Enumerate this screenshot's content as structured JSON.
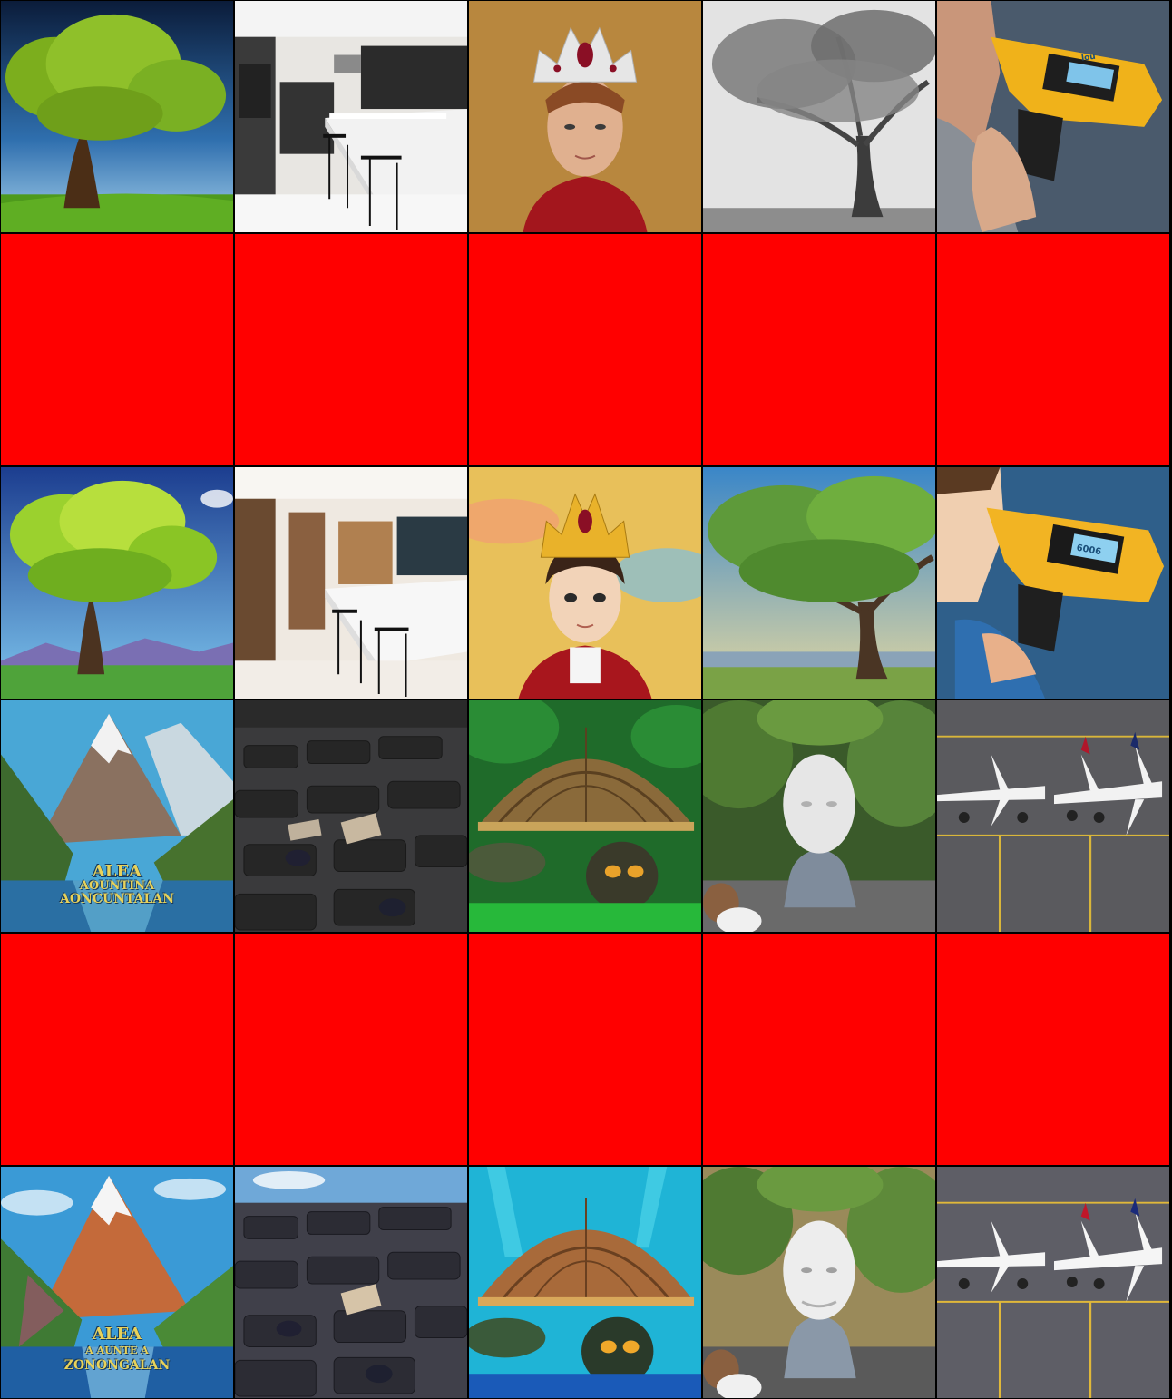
{
  "grid": {
    "columns": 5,
    "rows": 6,
    "placeholder_color": "#ff0000"
  },
  "rows": [
    {
      "kind": "photo",
      "tiles": [
        "tree-photo",
        "kitchen-photo",
        "crowned-woman-photo",
        "bw-oak-tree-photo",
        "power-drill-photo"
      ]
    },
    {
      "kind": "placeholder",
      "tiles": [
        "red-block",
        "red-block",
        "red-block",
        "red-block",
        "red-block"
      ]
    },
    {
      "kind": "stylized",
      "tiles": [
        "tree-anime",
        "kitchen-anime",
        "crowned-girl-anime",
        "oak-tree-anime",
        "power-drill-anime"
      ]
    },
    {
      "kind": "photo",
      "tiles": [
        "mountain-poster-photo",
        "lounge-seating-photo",
        "turtle-photo",
        "bust-statue-photo",
        "jets-tarmac-photo"
      ]
    },
    {
      "kind": "placeholder",
      "tiles": [
        "red-block",
        "red-block",
        "red-block",
        "red-block",
        "red-block"
      ]
    },
    {
      "kind": "stylized",
      "tiles": [
        "mountain-poster-anime",
        "lounge-seating-anime",
        "turtle-anime",
        "bust-statue-anime",
        "jets-tarmac-anime"
      ]
    }
  ],
  "poster_text": {
    "photo_line1": "ALEA",
    "photo_line2": "AOUNTINA",
    "photo_line3": "AONCUNTALAN",
    "anime_line1": "ALEA",
    "anime_line2": "A  AUNTE  A",
    "anime_line3": "ZONONGALAN"
  },
  "drill_text": {
    "photo": "lou",
    "anime": "6006"
  }
}
